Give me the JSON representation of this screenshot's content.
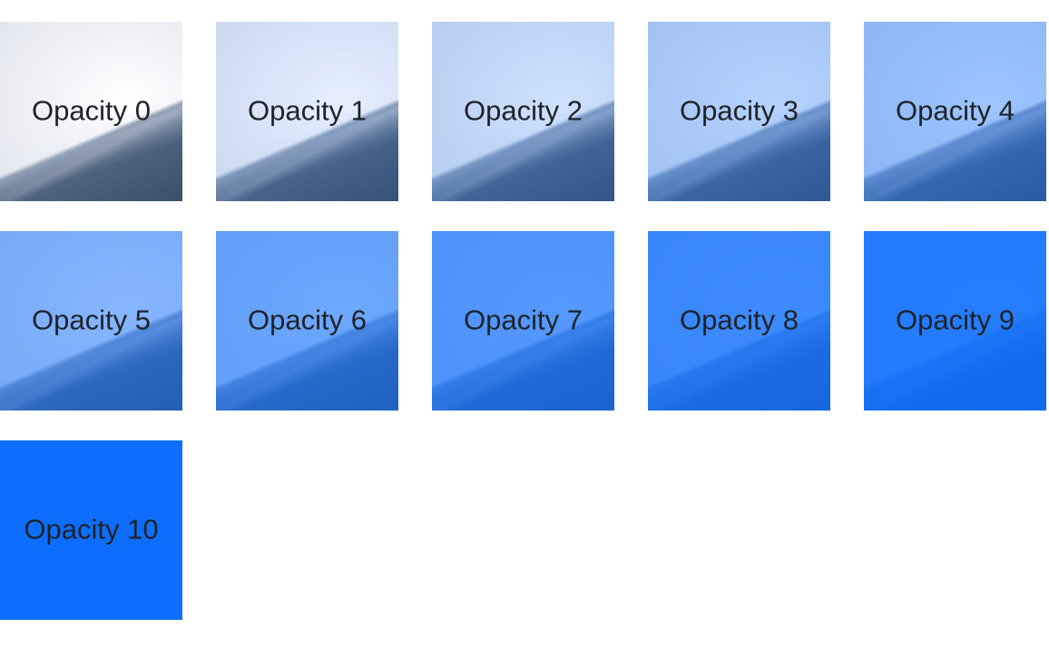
{
  "overlay_color": "#0d6efd",
  "tiles": [
    {
      "label": "Opacity 0",
      "opacity": 0
    },
    {
      "label": "Opacity 1",
      "opacity": 0.1
    },
    {
      "label": "Opacity 2",
      "opacity": 0.2
    },
    {
      "label": "Opacity 3",
      "opacity": 0.3
    },
    {
      "label": "Opacity 4",
      "opacity": 0.4
    },
    {
      "label": "Opacity 5",
      "opacity": 0.5
    },
    {
      "label": "Opacity 6",
      "opacity": 0.6
    },
    {
      "label": "Opacity 7",
      "opacity": 0.7
    },
    {
      "label": "Opacity 8",
      "opacity": 0.8
    },
    {
      "label": "Opacity 9",
      "opacity": 0.9
    },
    {
      "label": "Opacity 10",
      "opacity": 1
    }
  ]
}
